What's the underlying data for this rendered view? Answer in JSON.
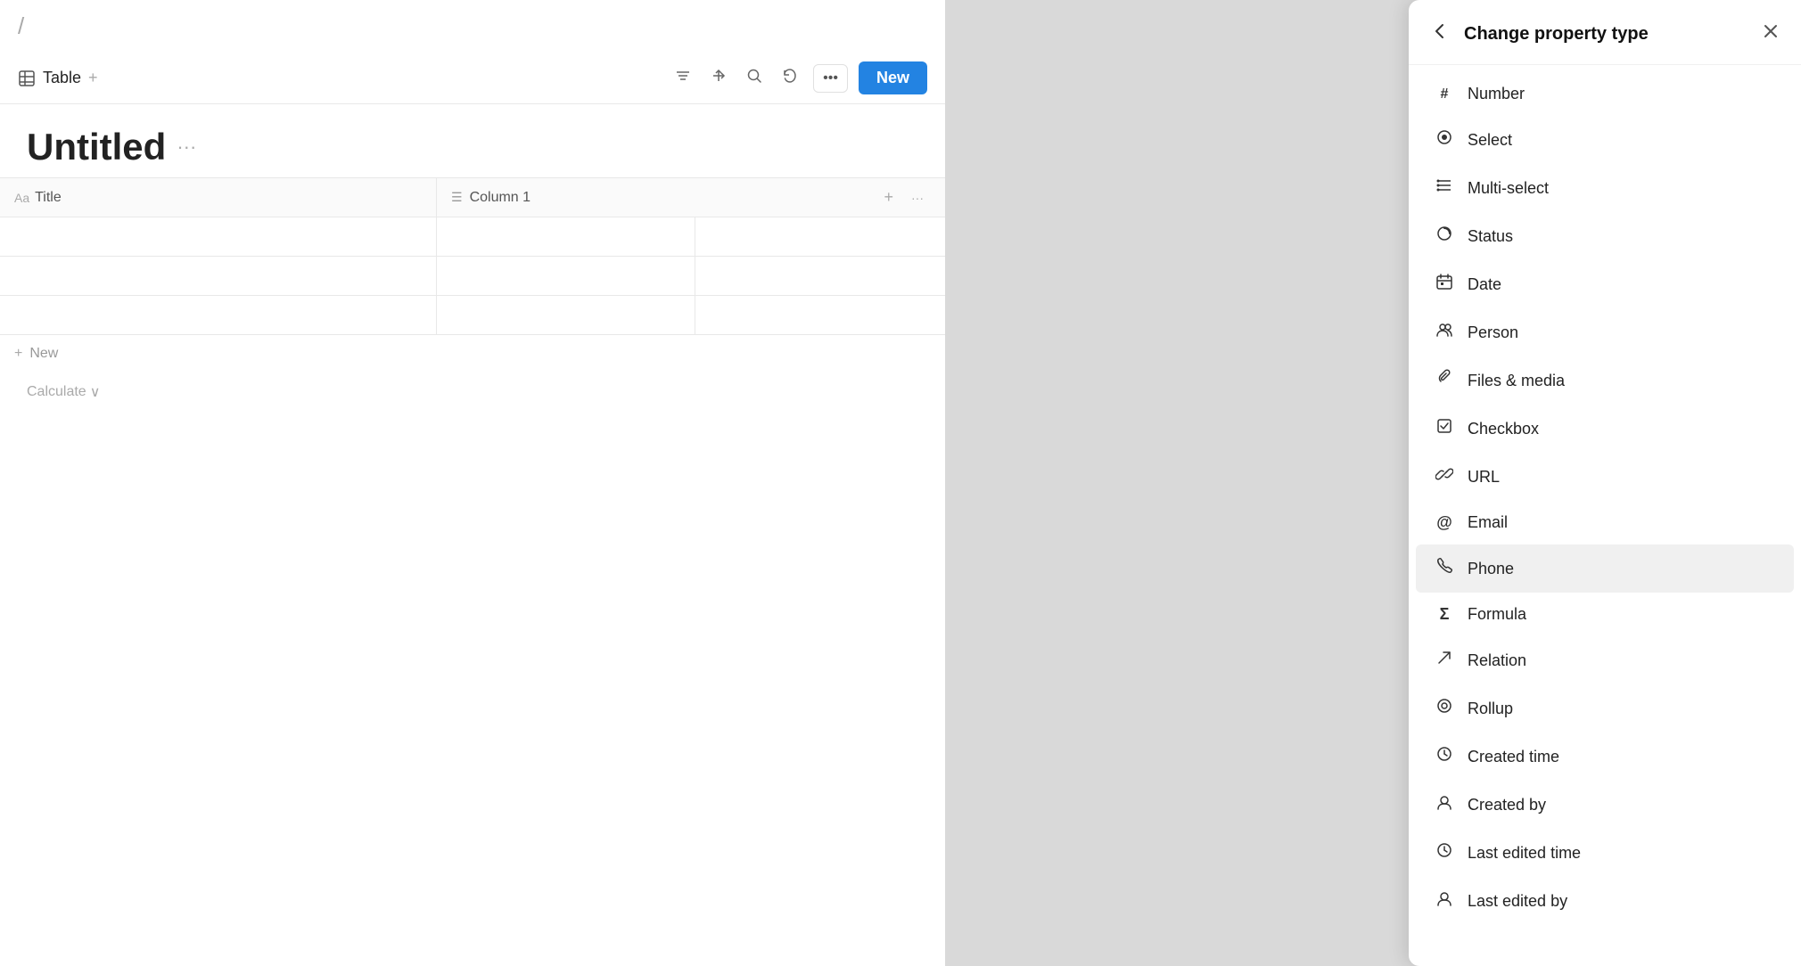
{
  "breadcrumb": {
    "separator": "/"
  },
  "toolbar": {
    "table_label": "Table",
    "add_label": "+",
    "new_label": "New",
    "icons": {
      "filter": "≡",
      "sort": "⇅",
      "search": "⌕",
      "undo": "↩",
      "more": "•••"
    }
  },
  "page": {
    "title": "Untitled",
    "title_more": "···"
  },
  "table": {
    "col_title_aa": "Aa",
    "col_title_label": "Title",
    "col_1_label": "Column 1",
    "col_add": "+",
    "col_more": "···",
    "rows": [
      {
        "id": 1
      },
      {
        "id": 2
      },
      {
        "id": 3
      }
    ],
    "new_row_label": "New",
    "calculate_label": "Calculate",
    "calculate_icon": "∨"
  },
  "panel": {
    "title": "Change property type",
    "items": [
      {
        "id": "number",
        "label": "Number",
        "icon": "#"
      },
      {
        "id": "select",
        "label": "Select",
        "icon": "◎"
      },
      {
        "id": "multi-select",
        "label": "Multi-select",
        "icon": "≡"
      },
      {
        "id": "status",
        "label": "Status",
        "icon": "✳"
      },
      {
        "id": "date",
        "label": "Date",
        "icon": "⊞"
      },
      {
        "id": "person",
        "label": "Person",
        "icon": "👥"
      },
      {
        "id": "files-media",
        "label": "Files & media",
        "icon": "🔗"
      },
      {
        "id": "checkbox",
        "label": "Checkbox",
        "icon": "☑"
      },
      {
        "id": "url",
        "label": "URL",
        "icon": "🔗"
      },
      {
        "id": "email",
        "label": "Email",
        "icon": "@"
      },
      {
        "id": "phone",
        "label": "Phone",
        "icon": "📞"
      },
      {
        "id": "formula",
        "label": "Formula",
        "icon": "Σ"
      },
      {
        "id": "relation",
        "label": "Relation",
        "icon": "↗"
      },
      {
        "id": "rollup",
        "label": "Rollup",
        "icon": "⊙"
      },
      {
        "id": "created-time",
        "label": "Created time",
        "icon": "⏱"
      },
      {
        "id": "created-by",
        "label": "Created by",
        "icon": "👤"
      },
      {
        "id": "last-edited-time",
        "label": "Last edited time",
        "icon": "⏱"
      },
      {
        "id": "last-edited-by",
        "label": "Last edited by",
        "icon": "👤"
      }
    ],
    "active_item": "phone"
  }
}
